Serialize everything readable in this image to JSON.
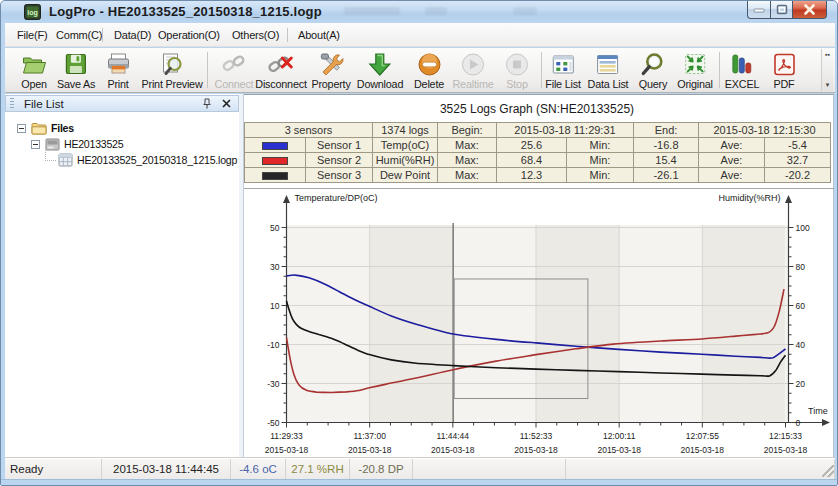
{
  "window": {
    "title": "LogPro - HE20133525_20150318_1215.logp"
  },
  "menu": {
    "items": [
      {
        "label": "File(F)",
        "sep_after": false
      },
      {
        "label": "Comm(C)",
        "sep_after": true
      },
      {
        "label": "Data(D)",
        "sep_after": false
      },
      {
        "label": "Operation(O)",
        "sep_after": false
      },
      {
        "label": "Others(O)",
        "sep_after": true
      },
      {
        "label": "About(A)",
        "sep_after": false
      }
    ]
  },
  "toolbar": {
    "buttons": [
      {
        "label": "Open",
        "icon": "open-folder",
        "disabled": false,
        "sep_after": false
      },
      {
        "label": "Save As",
        "icon": "save-floppy",
        "disabled": false,
        "sep_after": false
      },
      {
        "label": "Print",
        "icon": "printer",
        "disabled": false,
        "sep_after": false
      },
      {
        "label": "Print Preview",
        "icon": "print-preview",
        "disabled": false,
        "sep_after": true
      },
      {
        "label": "Connect",
        "icon": "connect-chain",
        "disabled": true,
        "sep_after": false
      },
      {
        "label": "Disconnect",
        "icon": "disconnect-chain",
        "disabled": false,
        "sep_after": false
      },
      {
        "label": "Property",
        "icon": "property-tools",
        "disabled": false,
        "sep_after": false
      },
      {
        "label": "Download",
        "icon": "download-arrow",
        "disabled": false,
        "sep_after": false
      },
      {
        "label": "Delete",
        "icon": "delete-circle",
        "disabled": false,
        "sep_after": false
      },
      {
        "label": "Realtime",
        "icon": "realtime-play",
        "disabled": true,
        "sep_after": false
      },
      {
        "label": "Stop",
        "icon": "stop-square",
        "disabled": true,
        "sep_after": true
      },
      {
        "label": "File List",
        "icon": "file-list",
        "disabled": false,
        "sep_after": false
      },
      {
        "label": "Data List",
        "icon": "data-list",
        "disabled": false,
        "sep_after": false
      },
      {
        "label": "Query",
        "icon": "query-magnifier",
        "disabled": false,
        "sep_after": false
      },
      {
        "label": "Original",
        "icon": "original-fit",
        "disabled": false,
        "sep_after": true
      },
      {
        "label": "EXCEL",
        "icon": "excel-chart",
        "disabled": false,
        "sep_after": false
      },
      {
        "label": "PDF",
        "icon": "pdf-doc",
        "disabled": false,
        "sep_after": false
      }
    ]
  },
  "file_panel": {
    "title": "File List",
    "tree": [
      {
        "label": "Files",
        "level": 0,
        "bold": true,
        "icon": "folder",
        "expander": true
      },
      {
        "label": "HE20133525",
        "level": 1,
        "bold": false,
        "icon": "device",
        "expander": true
      },
      {
        "label": "HE20133525_20150318_1215.logp",
        "level": 2,
        "bold": false,
        "icon": "log-file",
        "expander": false
      }
    ]
  },
  "main": {
    "graph_title": "3525 Logs Graph (SN:HE20133525)"
  },
  "summary_table": {
    "info_row": {
      "sensors": "3 sensors",
      "logs": "1374 logs",
      "begin_label": "Begin:",
      "begin": "2015-03-18 11:29:31",
      "end_label": "End:",
      "end": "2015-03-18 12:15:30"
    },
    "rows": [
      {
        "color": "#2a2fd0",
        "name": "Sensor 1",
        "type": "Temp(oC)",
        "max_label": "Max:",
        "max": "25.6",
        "min_label": "Min:",
        "min": "-16.8",
        "ave_label": "Ave:",
        "ave": "-5.4"
      },
      {
        "color": "#e02828",
        "name": "Sensor 2",
        "type": "Humi(%RH)",
        "max_label": "Max:",
        "max": "68.4",
        "min_label": "Min:",
        "min": "15.4",
        "ave_label": "Ave:",
        "ave": "32.7"
      },
      {
        "color": "#262626",
        "name": "Sensor 3",
        "type": "Dew Point",
        "max_label": "Max:",
        "max": "12.3",
        "min_label": "Min:",
        "min": "-26.1",
        "ave_label": "Ave:",
        "ave": "-20.2"
      }
    ]
  },
  "chart_data": {
    "type": "line",
    "left_axis": {
      "label": "Temperature/DP(oC)",
      "min": -50,
      "max": 50,
      "major_ticks": [
        50,
        30,
        10,
        -10,
        -30,
        -50
      ],
      "minor_step": 5
    },
    "right_axis": {
      "label": "Humidity(%RH)",
      "min": 0,
      "max": 100,
      "major_ticks": [
        100,
        80,
        60,
        40,
        20,
        0
      ],
      "minor_step": 5
    },
    "x_axis": {
      "label": "Time",
      "tick_times": [
        "11:29:33",
        "11:37:00",
        "11:44:44",
        "11:52:33",
        "12:00:11",
        "12:07:55",
        "12:15:33"
      ],
      "tick_date": "2015-03-18",
      "minor_per_major": 4
    },
    "grid": true,
    "band_colors": [
      "#f4f3ef",
      "#eceae5"
    ],
    "gridline_color": "#d8d5d0",
    "cursor": {
      "t": 0.334,
      "color": "#6a6a6a"
    },
    "selection": {
      "t0": 0.336,
      "t1": 0.604,
      "v_top": 23.6,
      "v_bottom": -37.7,
      "color": "#8f8f8f"
    },
    "series": [
      {
        "name": "Sensor 1 Temp(oC)",
        "axis": "left",
        "color": "#1c1c9e",
        "points": [
          [
            0.0,
            25.2
          ],
          [
            0.018,
            25.6
          ],
          [
            0.045,
            24.2
          ],
          [
            0.075,
            21.2
          ],
          [
            0.105,
            17.2
          ],
          [
            0.135,
            13.2
          ],
          [
            0.166,
            9.6
          ],
          [
            0.21,
            4.6
          ],
          [
            0.26,
            0.4
          ],
          [
            0.334,
            -4.6
          ],
          [
            0.42,
            -7.4
          ],
          [
            0.5,
            -9.2
          ],
          [
            0.58,
            -10.9
          ],
          [
            0.666,
            -12.5
          ],
          [
            0.75,
            -13.9
          ],
          [
            0.832,
            -15.0
          ],
          [
            0.9,
            -16.0
          ],
          [
            0.95,
            -16.6
          ],
          [
            0.975,
            -16.8
          ],
          [
            1.0,
            -12.3
          ]
        ]
      },
      {
        "name": "Sensor 2 Humi(%RH)",
        "axis": "right",
        "color": "#a83232",
        "points": [
          [
            0.0,
            43.5
          ],
          [
            0.007,
            33.0
          ],
          [
            0.015,
            24.5
          ],
          [
            0.025,
            19.3
          ],
          [
            0.04,
            16.5
          ],
          [
            0.06,
            15.6
          ],
          [
            0.09,
            15.4
          ],
          [
            0.12,
            15.7
          ],
          [
            0.145,
            16.4
          ],
          [
            0.166,
            17.8
          ],
          [
            0.2,
            19.7
          ],
          [
            0.26,
            22.8
          ],
          [
            0.334,
            27.1
          ],
          [
            0.42,
            31.5
          ],
          [
            0.5,
            34.8
          ],
          [
            0.58,
            37.8
          ],
          [
            0.655,
            40.2
          ],
          [
            0.75,
            41.8
          ],
          [
            0.832,
            42.8
          ],
          [
            0.9,
            44.3
          ],
          [
            0.94,
            45.2
          ],
          [
            0.965,
            46.0
          ],
          [
            0.978,
            49.5
          ],
          [
            0.988,
            57.5
          ],
          [
            0.997,
            68.4
          ]
        ]
      },
      {
        "name": "Sensor 3 Dew Point",
        "axis": "left",
        "color": "#141414",
        "points": [
          [
            0.0,
            12.3
          ],
          [
            0.005,
            8.0
          ],
          [
            0.012,
            3.2
          ],
          [
            0.02,
            0.2
          ],
          [
            0.03,
            -1.8
          ],
          [
            0.045,
            -3.3
          ],
          [
            0.065,
            -4.8
          ],
          [
            0.09,
            -6.8
          ],
          [
            0.115,
            -9.6
          ],
          [
            0.14,
            -12.6
          ],
          [
            0.166,
            -15.2
          ],
          [
            0.21,
            -17.9
          ],
          [
            0.26,
            -19.6
          ],
          [
            0.334,
            -20.8
          ],
          [
            0.42,
            -21.9
          ],
          [
            0.5,
            -22.6
          ],
          [
            0.58,
            -23.3
          ],
          [
            0.666,
            -23.9
          ],
          [
            0.75,
            -24.6
          ],
          [
            0.832,
            -25.2
          ],
          [
            0.9,
            -25.7
          ],
          [
            0.95,
            -26.0
          ],
          [
            0.968,
            -26.1
          ],
          [
            0.98,
            -23.5
          ],
          [
            0.99,
            -19.0
          ],
          [
            1.0,
            -15.5
          ]
        ]
      }
    ]
  },
  "statusbar": {
    "cells": [
      {
        "text": "Ready",
        "color": "#222222"
      },
      {
        "text": "2015-03-18 11:44:45",
        "color": "#222222"
      },
      {
        "text": "-4.6 oC",
        "color": "#4a64a8"
      },
      {
        "text": "27.1 %RH",
        "color": "#8a8a40"
      },
      {
        "text": "-20.8 DP",
        "color": "#6f6f52"
      },
      {
        "text": "",
        "color": "#222222"
      },
      {
        "text": "",
        "color": "#222222"
      }
    ]
  }
}
